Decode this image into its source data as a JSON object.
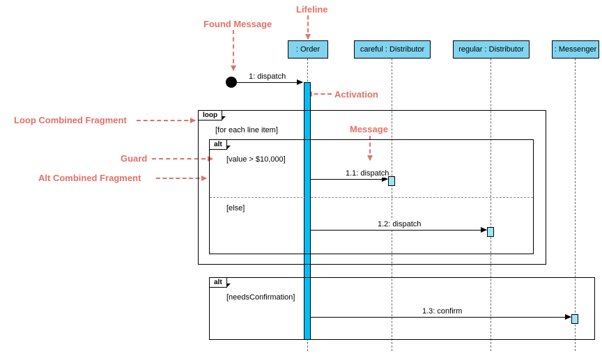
{
  "annotations": {
    "lifeline": "Lifeline",
    "found_message": "Found Message",
    "activation": "Activation",
    "loop_fragment": "Loop Combined Fragment",
    "message": "Message",
    "guard": "Guard",
    "alt_fragment": "Alt Combined Fragment"
  },
  "lifelines": {
    "order": ": Order",
    "careful": "careful : Distributor",
    "regular": "regular : Distributor",
    "messenger": ": Messenger"
  },
  "messages": {
    "m1": "1: dispatch",
    "m11": "1.1: dispatch",
    "m12": "1.2: dispatch",
    "m13": "1.3: confirm"
  },
  "fragments": {
    "loop": {
      "label": "loop",
      "guard": "[for each line item]"
    },
    "alt1": {
      "label": "alt",
      "guard1": "[value > $10,000]",
      "guard2": "[else]"
    },
    "alt2": {
      "label": "alt",
      "guard": "[needsConfirmation]"
    }
  },
  "chart_data": {
    "type": "uml-sequence-diagram",
    "lifelines": [
      {
        "name": ": Order",
        "role": "Order"
      },
      {
        "name": "careful : Distributor",
        "role": "Distributor"
      },
      {
        "name": "regular : Distributor",
        "role": "Distributor"
      },
      {
        "name": ": Messenger",
        "role": "Messenger"
      }
    ],
    "messages": [
      {
        "id": "1",
        "label": "dispatch",
        "from": "found",
        "to": ": Order",
        "type": "found"
      },
      {
        "id": "1.1",
        "label": "dispatch",
        "from": ": Order",
        "to": "careful : Distributor"
      },
      {
        "id": "1.2",
        "label": "dispatch",
        "from": ": Order",
        "to": "regular : Distributor"
      },
      {
        "id": "1.3",
        "label": "confirm",
        "from": ": Order",
        "to": ": Messenger"
      }
    ],
    "fragments": [
      {
        "type": "loop",
        "guard": "for each line item",
        "contains": [
          "alt1"
        ]
      },
      {
        "id": "alt1",
        "type": "alt",
        "operands": [
          {
            "guard": "value > $10,000",
            "messages": [
              "1.1"
            ]
          },
          {
            "guard": "else",
            "messages": [
              "1.2"
            ]
          }
        ]
      },
      {
        "id": "alt2",
        "type": "alt",
        "operands": [
          {
            "guard": "needsConfirmation",
            "messages": [
              "1.3"
            ]
          }
        ]
      }
    ],
    "annotations": [
      "Lifeline",
      "Found Message",
      "Activation",
      "Loop Combined Fragment",
      "Message",
      "Guard",
      "Alt Combined Fragment"
    ]
  }
}
